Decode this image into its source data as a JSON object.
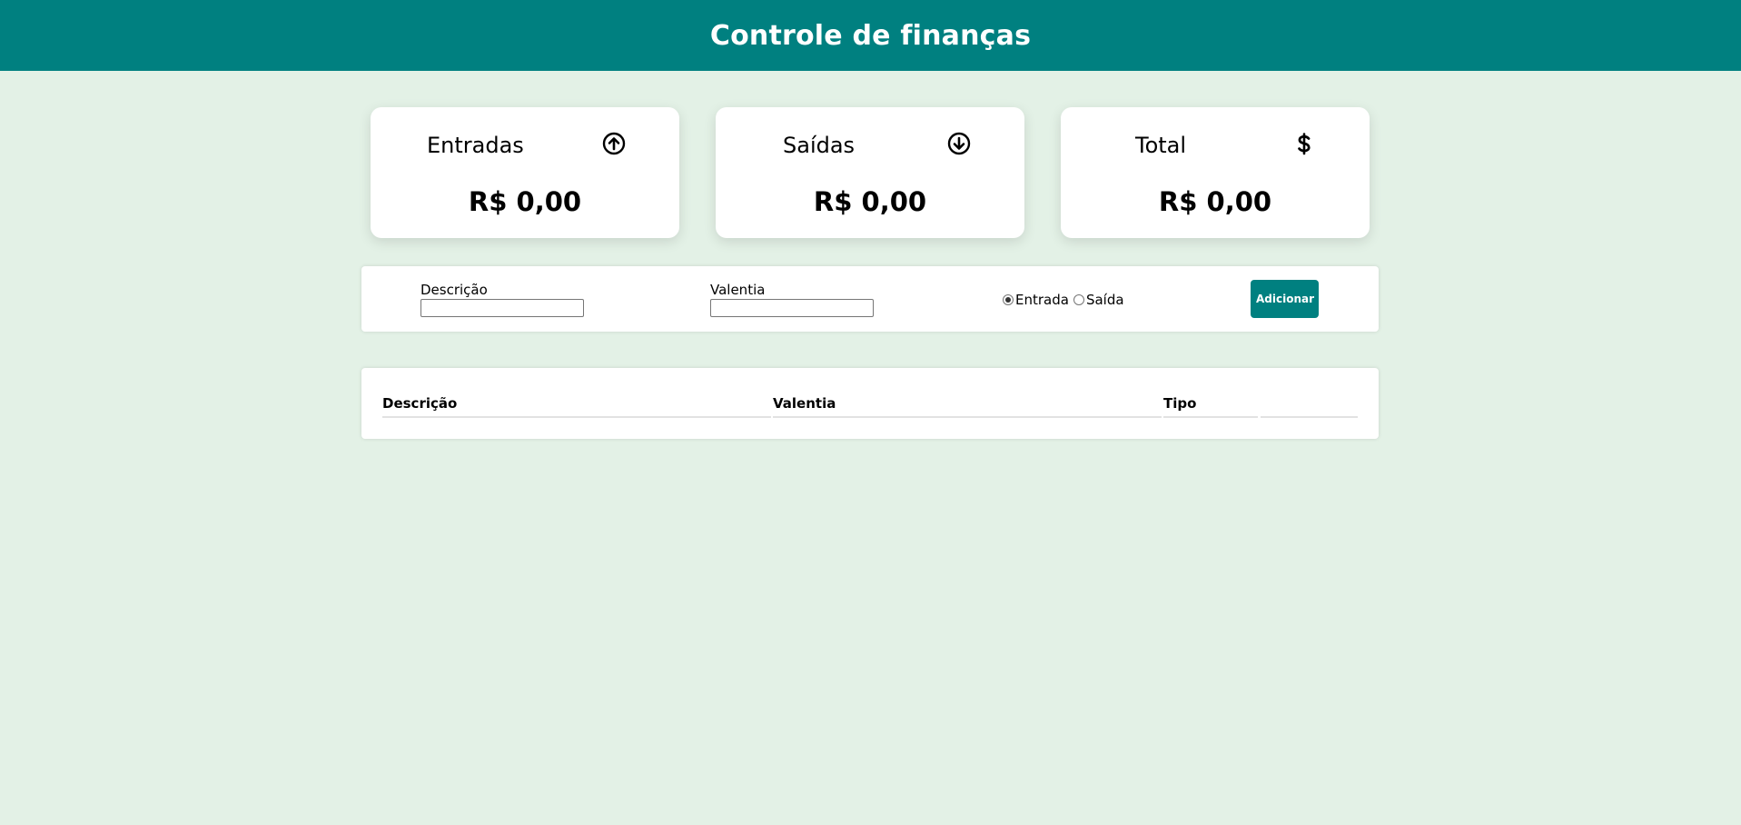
{
  "header": {
    "title": "Controle de finanças"
  },
  "summary": {
    "cards": [
      {
        "label": "Entradas",
        "icon": "arrow-up-circle-icon",
        "value": "R$ 0,00"
      },
      {
        "label": "Saídas",
        "icon": "arrow-down-circle-icon",
        "value": "R$ 0,00"
      },
      {
        "label": "Total",
        "icon": "dollar-icon",
        "value": "R$ 0,00"
      }
    ]
  },
  "form": {
    "description_label": "Descrição",
    "description_value": "",
    "amount_label": "Valentia",
    "amount_value": "",
    "type_options": [
      {
        "label": "Entrada",
        "selected": true
      },
      {
        "label": "Saída",
        "selected": false
      }
    ],
    "add_button": "Adicionar"
  },
  "table": {
    "columns": [
      "Descrição",
      "Valentia",
      "Tipo",
      ""
    ],
    "rows": []
  },
  "colors": {
    "brand": "#008080",
    "background": "#e3f1e6",
    "card": "#ffffff"
  }
}
